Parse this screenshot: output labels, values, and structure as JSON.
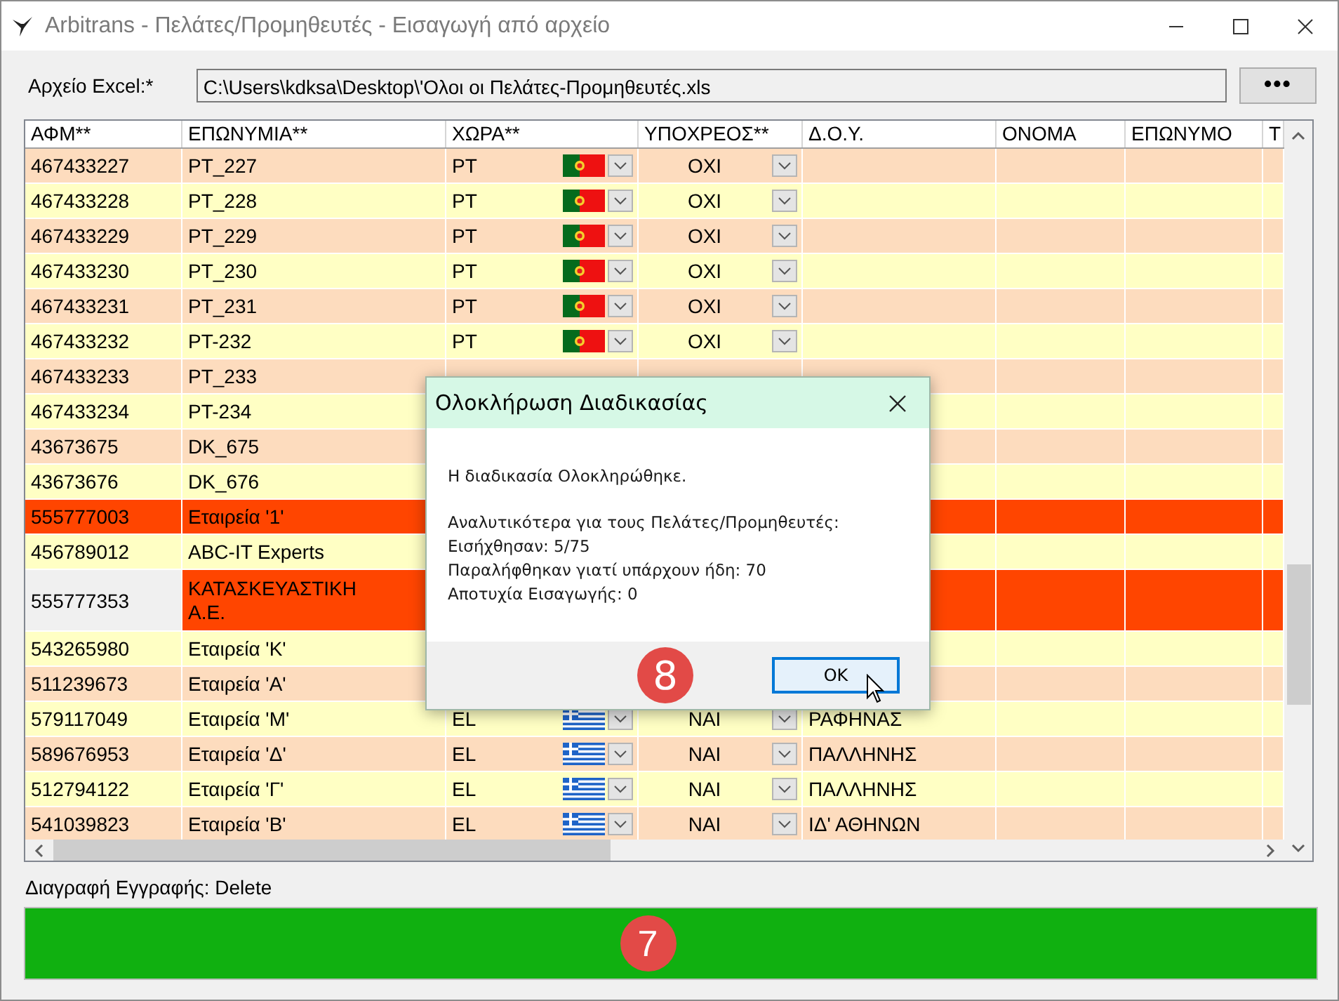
{
  "window": {
    "title": "Arbitrans - Πελάτες/Προμηθευτές - Εισαγωγή από αρχείο"
  },
  "file": {
    "label": "Αρχείο Excel:*",
    "value": "C:\\Users\\kdksa\\Desktop\\'Ολοι οι Πελάτες-Προμηθευτές.xls",
    "browse_button": "•••"
  },
  "table": {
    "columns": [
      "ΑΦΜ**",
      "ΕΠΩΝΥΜΙΑ**",
      "ΧΩΡΑ**",
      "ΥΠΟΧΡΕΟΣ**",
      "Δ.Ο.Υ.",
      "ΟΝΟΜΑ",
      "ΕΠΩΝΥΜΟ",
      "Τ"
    ],
    "rows": [
      {
        "afm": "467433227",
        "name": "PT_227",
        "country": "PT",
        "kind": "portugal",
        "obliged": "ΟΧΙ",
        "error": false,
        "current": false
      },
      {
        "afm": "467433228",
        "name": "PT_228",
        "country": "PT",
        "kind": "portugal",
        "obliged": "ΟΧΙ",
        "error": false,
        "current": false
      },
      {
        "afm": "467433229",
        "name": "PT_229",
        "country": "PT",
        "kind": "portugal",
        "obliged": "ΟΧΙ",
        "error": false,
        "current": false
      },
      {
        "afm": "467433230",
        "name": "PT_230",
        "country": "PT",
        "kind": "portugal",
        "obliged": "ΟΧΙ",
        "error": false,
        "current": false
      },
      {
        "afm": "467433231",
        "name": "PT_231",
        "country": "PT",
        "kind": "portugal",
        "obliged": "ΟΧΙ",
        "error": false,
        "current": false
      },
      {
        "afm": "467433232",
        "name": "PT-232",
        "country": "PT",
        "kind": "portugal",
        "obliged": "ΟΧΙ",
        "error": false,
        "current": false
      },
      {
        "afm": "467433233",
        "name": "PT_233",
        "error": false,
        "current": false
      },
      {
        "afm": "467433234",
        "name": "PT-234",
        "error": false,
        "current": false
      },
      {
        "afm": "43673675",
        "name": "DK_675",
        "error": false,
        "current": false
      },
      {
        "afm": "43673676",
        "name": "DK_676",
        "error": false,
        "current": false
      },
      {
        "afm": "555777003",
        "name": "Εταιρεία '1'",
        "error": true,
        "current": false
      },
      {
        "afm": "456789012",
        "name": "ABC-IT Experts",
        "error": false,
        "current": false
      },
      {
        "afm": "555777353",
        "name": "ΚΑΤΑΣΚΕΥΑΣΤΙΚΗ Α.Ε.",
        "error": true,
        "current": true
      },
      {
        "afm": "543265980",
        "name": "Εταιρεία 'Κ'",
        "error": false,
        "current": false
      },
      {
        "afm": "511239673",
        "name": "Εταιρεία 'Α'",
        "error": false,
        "current": false
      },
      {
        "afm": "579117049",
        "name": "Εταιρεία 'Μ'",
        "country": "EL",
        "kind": "greece",
        "obliged": "ΝΑΙ",
        "doy": "ΡΑΦΗΝΑΣ",
        "error": false,
        "current": false
      },
      {
        "afm": "589676953",
        "name": "Εταιρεία 'Δ'",
        "country": "EL",
        "kind": "greece",
        "obliged": "ΝΑΙ",
        "doy": "ΠΑΛΛΗΝΗΣ",
        "error": false,
        "current": false
      },
      {
        "afm": "512794122",
        "name": "Εταιρεία 'Γ'",
        "country": "EL",
        "kind": "greece",
        "obliged": "ΝΑΙ",
        "doy": "ΠΑΛΛΗΝΗΣ",
        "error": false,
        "current": false
      },
      {
        "afm": "541039823",
        "name": "Εταιρεία 'Β'",
        "country": "EL",
        "kind": "greece",
        "obliged": "ΝΑΙ",
        "doy": "ΙΔ' ΑΘΗΝΩΝ",
        "error": false,
        "current": false
      }
    ]
  },
  "hint": "Διαγραφή Εγγραφής: Delete",
  "progress": {
    "level": 1,
    "badge": "7"
  },
  "dialog": {
    "title": "Ολοκλήρωση Διαδικασίας",
    "message": "Η διαδικασία Ολοκληρώθηκε.",
    "details": [
      "Αναλυτικότερα για τους Πελάτες/Προμηθευτές:",
      "Εισήχθησαν: 5/75",
      "Παραλήφθηκαν γιατί υπάρχουν ήδη: 70",
      "Αποτυχία Εισαγωγής: 0"
    ],
    "badge": "8",
    "ok_button": "OK"
  }
}
